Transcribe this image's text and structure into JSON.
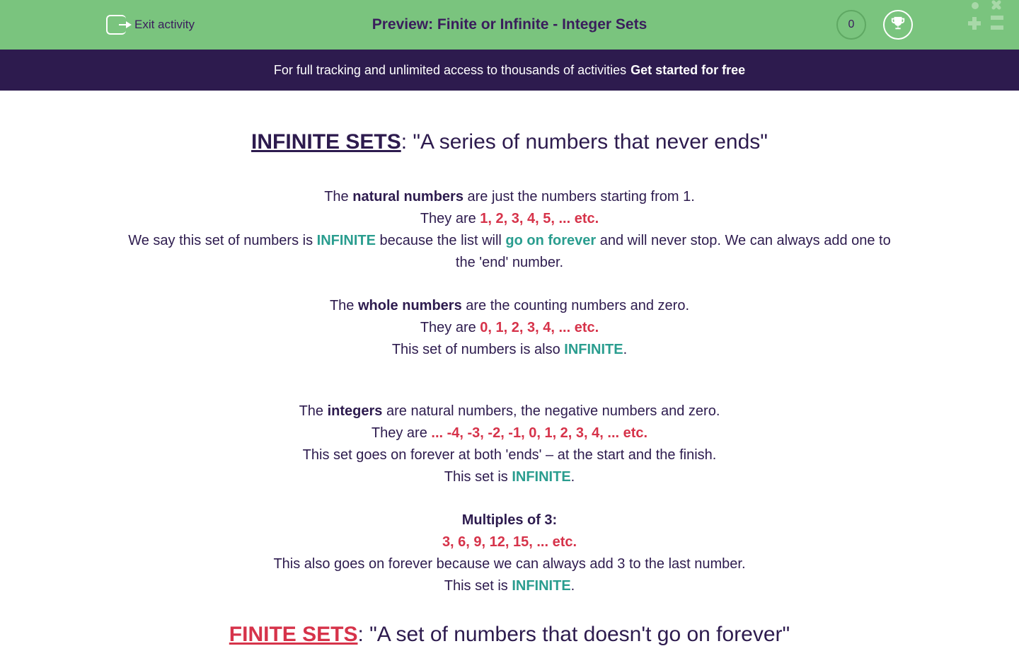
{
  "header": {
    "exit_label": "Exit activity",
    "title": "Preview: Finite or Infinite - Integer Sets",
    "score": "0"
  },
  "banner": {
    "text": "For full tracking and unlimited access to thousands of activities",
    "cta": "Get started for free"
  },
  "content": {
    "infinite_heading_term": "INFINITE SETS",
    "infinite_heading_definition": ": \"A series of numbers that never ends\"",
    "natural": {
      "p1_before": "The ",
      "p1_bold": "natural numbers",
      "p1_after": " are just the numbers starting from 1.",
      "p2_before": "They are ",
      "p2_red": "1, 2, 3, 4, 5, ... etc.",
      "p3_before": "We say this set of numbers is ",
      "p3_teal": "INFINITE",
      "p3_mid": " because the list will ",
      "p3_teal2": "go on forever",
      "p3_after": " and will never stop. We can always add one to the 'end' number."
    },
    "whole": {
      "p1_before": "The ",
      "p1_bold": "whole numbers",
      "p1_after": " are the counting numbers and zero.",
      "p2_before": "They are  ",
      "p2_red": "0, 1, 2, 3, 4, ... etc.",
      "p3_before": "This set of numbers is also ",
      "p3_teal": "INFINITE",
      "p3_after": "."
    },
    "integers": {
      "p1_before": "The ",
      "p1_bold": "integers",
      "p1_after": " are natural numbers, the negative numbers and zero.",
      "p2_before": "They are ",
      "p2_red": "... -4, -3, -2, -1, 0, 1, 2, 3, 4, ... etc.",
      "p3": "This set goes on forever at both 'ends' – at the start and the finish. ",
      "p4_before": "This set is ",
      "p4_teal": "INFINITE",
      "p4_after": "."
    },
    "multiples": {
      "p1_bold": "Multiples of 3:",
      "p2_red": "3, 6, 9, 12, 15, ... etc.",
      "p3": "This also goes on forever because we can always add 3 to the last number.",
      "p4_before": "This set is ",
      "p4_teal": "INFINITE",
      "p4_after": "."
    },
    "finite_heading_term": "FINITE SETS",
    "finite_heading_definition": ": \"A set of numbers that doesn't go on forever\""
  }
}
